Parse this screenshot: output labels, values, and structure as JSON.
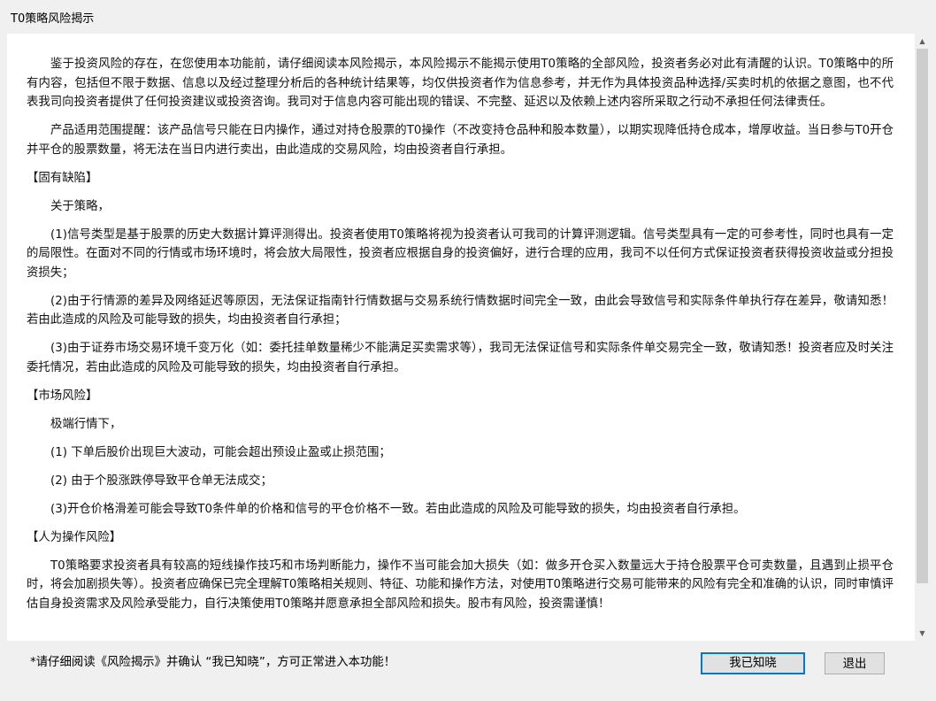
{
  "window": {
    "title": "T0策略风险揭示"
  },
  "content": {
    "intro_paragraphs": [
      "鉴于投资风险的存在，在您使用本功能前，请仔细阅读本风险揭示，本风险揭示不能揭示使用T0策略的全部风险，投资者务必对此有清醒的认识。T0策略中的所有内容，包括但不限于数据、信息以及经过整理分析后的各种统计结果等，均仅供投资者作为信息参考，并无作为具体投资品种选择/买卖时机的依据之意图，也不代表我司向投资者提供了任何投资建议或投资咨询。我司对于信息内容可能出现的错误、不完整、延迟以及依赖上述内容所采取之行动不承担任何法律责任。",
      "产品适用范围提醒：该产品信号只能在日内操作，通过对持仓股票的T0操作（不改变持仓品种和股本数量），以期实现降低持仓成本，增厚收益。当日参与T0开仓并平仓的股票数量，将无法在当日内进行卖出，由此造成的交易风险，均由投资者自行承担。"
    ],
    "section_inherent": {
      "heading": "【固有缺陷】",
      "lead": "关于策略，",
      "items": [
        "(1)信号类型是基于股票的历史大数据计算评测得出。投资者使用T0策略将视为投资者认可我司的计算评测逻辑。信号类型具有一定的可参考性，同时也具有一定的局限性。在面对不同的行情或市场环境时，将会放大局限性，投资者应根据自身的投资偏好，进行合理的应用，我司不以任何方式保证投资者获得投资收益或分担投资损失；",
        "(2)由于行情源的差异及网络延迟等原因，无法保证指南针行情数据与交易系统行情数据时间完全一致，由此会导致信号和实际条件单执行存在差异，敬请知悉！若由此造成的风险及可能导致的损失，均由投资者自行承担；",
        "(3)由于证券市场交易环境千变万化（如：委托挂单数量稀少不能满足买卖需求等），我司无法保证信号和实际条件单交易完全一致，敬请知悉！投资者应及时关注委托情况，若由此造成的风险及可能导致的损失，均由投资者自行承担。"
      ]
    },
    "section_market": {
      "heading": "【市场风险】",
      "lead": "极端行情下，",
      "items": [
        "(1) 下单后股价出现巨大波动，可能会超出预设止盈或止损范围；",
        "(2) 由于个股涨跌停导致平仓单无法成交；",
        "(3)开仓价格滑差可能会导致T0条件单的价格和信号的平仓价格不一致。若由此造成的风险及可能导致的损失，均由投资者自行承担。"
      ]
    },
    "section_human": {
      "heading": "【人为操作风险】",
      "text": "T0策略要求投资者具有较高的短线操作技巧和市场判断能力，操作不当可能会加大损失（如：做多开仓买入数量远大于持仓股票平仓可卖数量，且遇到止损平仓时，将会加剧损失等）。投资者应确保已完全理解T0策略相关规则、特征、功能和操作方法，对使用T0策略进行交易可能带来的风险有完全和准确的认识，同时审慎评估自身投资需求及风险承受能力，自行决策使用T0策略并愿意承担全部风险和损失。股市有风险，投资需谨慎！"
    }
  },
  "footer": {
    "note": "*请仔细阅读《风险揭示》并确认 “我已知晓”，方可正常进入本功能！",
    "confirm_label": "我已知晓",
    "exit_label": "退出"
  },
  "scrollbar": {
    "up_icon": "▲",
    "down_icon": "▼"
  }
}
